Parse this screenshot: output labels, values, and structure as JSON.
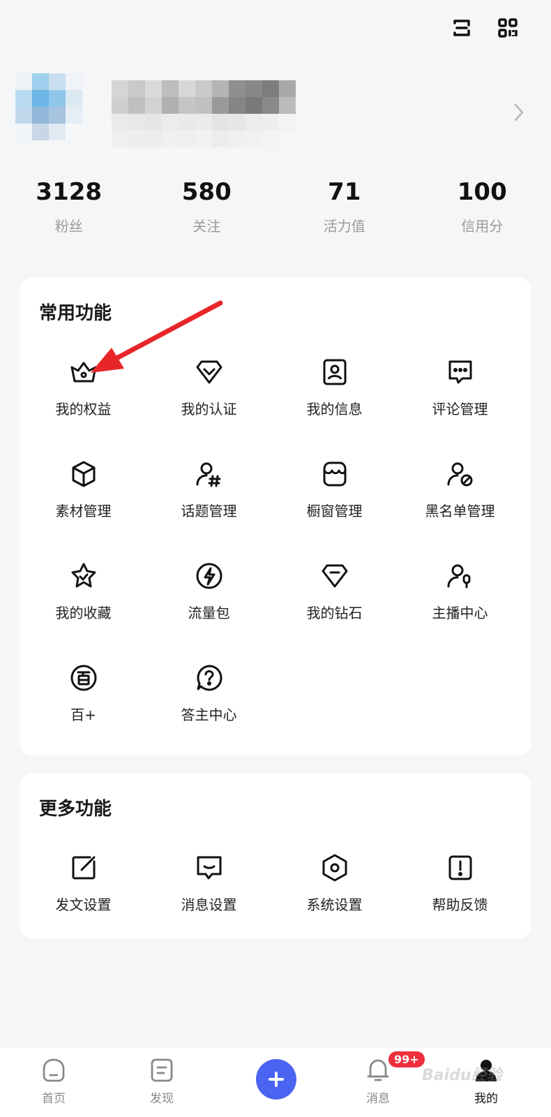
{
  "top_icons": [
    "scan-icon",
    "qr-code-icon"
  ],
  "stats": [
    {
      "value": "3128",
      "label": "粉丝"
    },
    {
      "value": "580",
      "label": "关注"
    },
    {
      "value": "71",
      "label": "活力值"
    },
    {
      "value": "100",
      "label": "信用分"
    }
  ],
  "common": {
    "title": "常用功能",
    "items": [
      {
        "label": "我的权益",
        "icon": "crown-icon"
      },
      {
        "label": "我的认证",
        "icon": "verify-icon"
      },
      {
        "label": "我的信息",
        "icon": "profile-card-icon"
      },
      {
        "label": "评论管理",
        "icon": "comment-icon"
      },
      {
        "label": "素材管理",
        "icon": "cube-icon"
      },
      {
        "label": "话题管理",
        "icon": "topic-icon"
      },
      {
        "label": "橱窗管理",
        "icon": "shop-icon"
      },
      {
        "label": "黑名单管理",
        "icon": "block-user-icon"
      },
      {
        "label": "我的收藏",
        "icon": "star-icon"
      },
      {
        "label": "流量包",
        "icon": "lightning-icon"
      },
      {
        "label": "我的钻石",
        "icon": "diamond-icon"
      },
      {
        "label": "主播中心",
        "icon": "anchor-icon"
      },
      {
        "label": "百+",
        "icon": "bai-plus-icon"
      },
      {
        "label": "答主中心",
        "icon": "question-icon"
      }
    ]
  },
  "more": {
    "title": "更多功能",
    "items": [
      {
        "label": "发文设置",
        "icon": "edit-icon"
      },
      {
        "label": "消息设置",
        "icon": "message-icon"
      },
      {
        "label": "系统设置",
        "icon": "settings-icon"
      },
      {
        "label": "帮助反馈",
        "icon": "feedback-icon"
      }
    ]
  },
  "bottom_nav": {
    "items": [
      {
        "label": "首页",
        "icon": "home-icon"
      },
      {
        "label": "发现",
        "icon": "discover-icon"
      },
      {
        "label": "消息",
        "icon": "bell-icon"
      },
      {
        "label": "我的",
        "icon": "user-icon"
      }
    ],
    "badge": "99+",
    "active": "我的"
  },
  "watermark": "Baidu经验",
  "colors": {
    "accent": "#4a63f0",
    "badge": "#ef2f3c",
    "arrow": "#e8262a"
  }
}
